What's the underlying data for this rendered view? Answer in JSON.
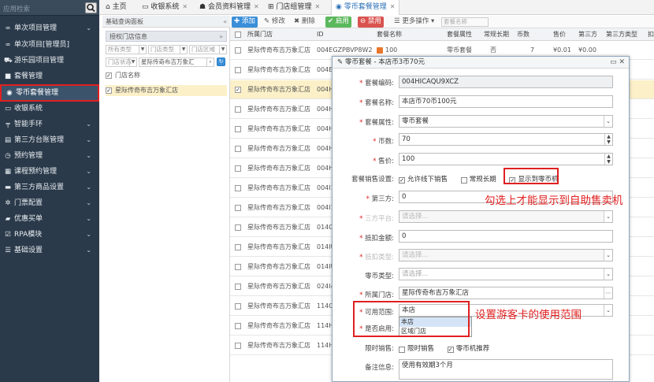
{
  "sidebar": {
    "search_placeholder": "应用检索",
    "items": [
      {
        "icon": "∞",
        "label": "单次项目管理",
        "chevron": "⌄"
      },
      {
        "icon": "∞",
        "label": "单次项目[管理员]",
        "chevron": ""
      },
      {
        "icon": "⛟",
        "label": "游乐园项目管理",
        "chevron": ""
      },
      {
        "icon": "■",
        "label": "套餐管理",
        "chevron": ""
      },
      {
        "icon": "◉",
        "label": "零币套餐管理",
        "chevron": ""
      },
      {
        "icon": "▭",
        "label": "收银系统",
        "chevron": ""
      },
      {
        "icon": "╤",
        "label": "智能手环",
        "chevron": "⌄"
      },
      {
        "icon": "▤",
        "label": "第三方台账管理",
        "chevron": "⌄"
      },
      {
        "icon": "◷",
        "label": "预约管理",
        "chevron": "⌄"
      },
      {
        "icon": "▦",
        "label": "课程预约管理",
        "chevron": "⌄"
      },
      {
        "icon": "▬",
        "label": "第三方商品设置",
        "chevron": "⌄"
      },
      {
        "icon": "✲",
        "label": "门票配置",
        "chevron": "⌄"
      },
      {
        "icon": "▰",
        "label": "优惠买单",
        "chevron": "⌄"
      },
      {
        "icon": "☑",
        "label": "RPA模块",
        "chevron": "⌄"
      },
      {
        "icon": "☰",
        "label": "基础设置",
        "chevron": "⌄"
      }
    ]
  },
  "tabs": [
    {
      "icon": "⌂",
      "label": "主页"
    },
    {
      "icon": "▭",
      "label": "收银系统"
    },
    {
      "icon": "☗",
      "label": "会员资料管理"
    },
    {
      "icon": "⊞",
      "label": "门店组管理"
    },
    {
      "icon": "◉",
      "label": "零币套餐管理"
    }
  ],
  "left_panel": {
    "title": "基础查询面板",
    "sub_title": "授权门店信息",
    "selects": [
      "所有类型",
      "门店类型",
      "门店区域",
      "门店状态",
      "星际传奇布吉万象汇"
    ],
    "header_label": "门店名称",
    "row_label": "星际传奇布吉万象汇店"
  },
  "toolbar": {
    "add": "添加",
    "edit": "修改",
    "delete": "删除",
    "enable": "启用",
    "disable": "禁用",
    "more": "更多操作",
    "search_placeholder": "套餐名称"
  },
  "table": {
    "headers": [
      "所属门店",
      "ID",
      "套餐名称",
      "套餐属性",
      "常规长期",
      "币数",
      "售价",
      "第三方",
      "第三方类型",
      "扣"
    ],
    "rows": [
      {
        "store": "星际传奇布吉万象汇店",
        "id": "004EGZPBVP8W2",
        "name": "100",
        "attr": "零币套餐",
        "long": "否",
        "coins": "7",
        "price": "¥0.01",
        "third": "¥0.00"
      },
      {
        "store": "星际传奇布吉万象汇店",
        "id": "004EG",
        "name": "",
        "attr": "",
        "long": "",
        "coins": "",
        "price": "",
        "third": ""
      },
      {
        "store": "星际传奇布吉万象汇店",
        "id": "004HI",
        "name": "",
        "attr": "",
        "long": "",
        "coins": "",
        "price": "",
        "third": ""
      },
      {
        "store": "星际传奇布吉万象汇店",
        "id": "004HI",
        "name": "",
        "attr": "",
        "long": "",
        "coins": "",
        "price": "",
        "third": ""
      },
      {
        "store": "星际传奇布吉万象汇店",
        "id": "004H",
        "name": "",
        "attr": "",
        "long": "",
        "coins": "",
        "price": "",
        "third": ""
      },
      {
        "store": "星际传奇布吉万象汇店",
        "id": "004H",
        "name": "",
        "attr": "",
        "long": "",
        "coins": "",
        "price": "",
        "third": ""
      },
      {
        "store": "星际传奇布吉万象汇店",
        "id": "004H",
        "name": "",
        "attr": "",
        "long": "",
        "coins": "",
        "price": "",
        "third": ""
      },
      {
        "store": "星际传奇布吉万象汇店",
        "id": "004I1",
        "name": "",
        "attr": "",
        "long": "",
        "coins": "",
        "price": "",
        "third": ""
      },
      {
        "store": "星际传奇布吉万象汇店",
        "id": "004I1",
        "name": "",
        "attr": "",
        "long": "",
        "coins": "",
        "price": "",
        "third": ""
      },
      {
        "store": "星际传奇布吉万象汇店",
        "id": "014G",
        "name": "",
        "attr": "",
        "long": "",
        "coins": "",
        "price": "",
        "third": ""
      },
      {
        "store": "星际传奇布吉万象汇店",
        "id": "014IU",
        "name": "",
        "attr": "",
        "long": "",
        "coins": "",
        "price": "",
        "third": ""
      },
      {
        "store": "星际传奇布吉万象汇店",
        "id": "014IU",
        "name": "",
        "attr": "",
        "long": "",
        "coins": "",
        "price": "",
        "third": ""
      },
      {
        "store": "星际传奇布吉万象汇店",
        "id": "024I4",
        "name": "",
        "attr": "",
        "long": "",
        "coins": "",
        "price": "",
        "third": ""
      },
      {
        "store": "星际传奇布吉万象汇店",
        "id": "114G",
        "name": "",
        "attr": "",
        "long": "",
        "coins": "",
        "price": "",
        "third": ""
      },
      {
        "store": "星际传奇布吉万象汇店",
        "id": "114H",
        "name": "",
        "attr": "",
        "long": "",
        "coins": "",
        "price": "",
        "third": ""
      },
      {
        "store": "星际传奇布吉万象汇店",
        "id": "114H",
        "name": "",
        "attr": "",
        "long": "",
        "coins": "",
        "price": "",
        "third": ""
      }
    ]
  },
  "dialog": {
    "title": "零币套餐 - 本店币3币70元",
    "fields": {
      "code_label": "套餐编码:",
      "code_value": "004HICAQU9XCZ",
      "name_label": "套餐名称:",
      "name_value": "本店币70币100元",
      "attr_label": "套餐属性:",
      "attr_value": "零币套餐",
      "coins_label": "币数:",
      "coins_value": "70",
      "price_label": "售价:",
      "price_value": "100",
      "sale_label": "套餐销售设置:",
      "opt_offline": "允许线下销售",
      "opt_regular": "常规长期",
      "opt_machine": "显示到零币机",
      "third_label": "第三方:",
      "third_value": "0",
      "platform_label": "三方平台:",
      "platform_placeholder": "请选择...",
      "deduct_label": "抵扣金额:",
      "deduct_value": "0",
      "deduct_type_label": "抵扣类型:",
      "deduct_type_placeholder": "请选择...",
      "coin_type_label": "零币类型:",
      "coin_type_placeholder": "请选择...",
      "store_label": "所属门店:",
      "store_value": "星际传奇布吉万象汇店",
      "range_label": "可用范围:",
      "range_value": "本店",
      "range_options": [
        "本店",
        "区域门店"
      ],
      "enable_label": "是否启用:",
      "limit_label": "限时销售:",
      "opt_limit": "限时销售",
      "opt_recommend": "零币机推荐",
      "remark_label": "备注信息:",
      "remark_value": "使用有效期3个月"
    }
  },
  "annotations": {
    "machine_note": "勾选上才能显示到自助售卖机",
    "range_note": "设置游客卡的使用范围"
  }
}
